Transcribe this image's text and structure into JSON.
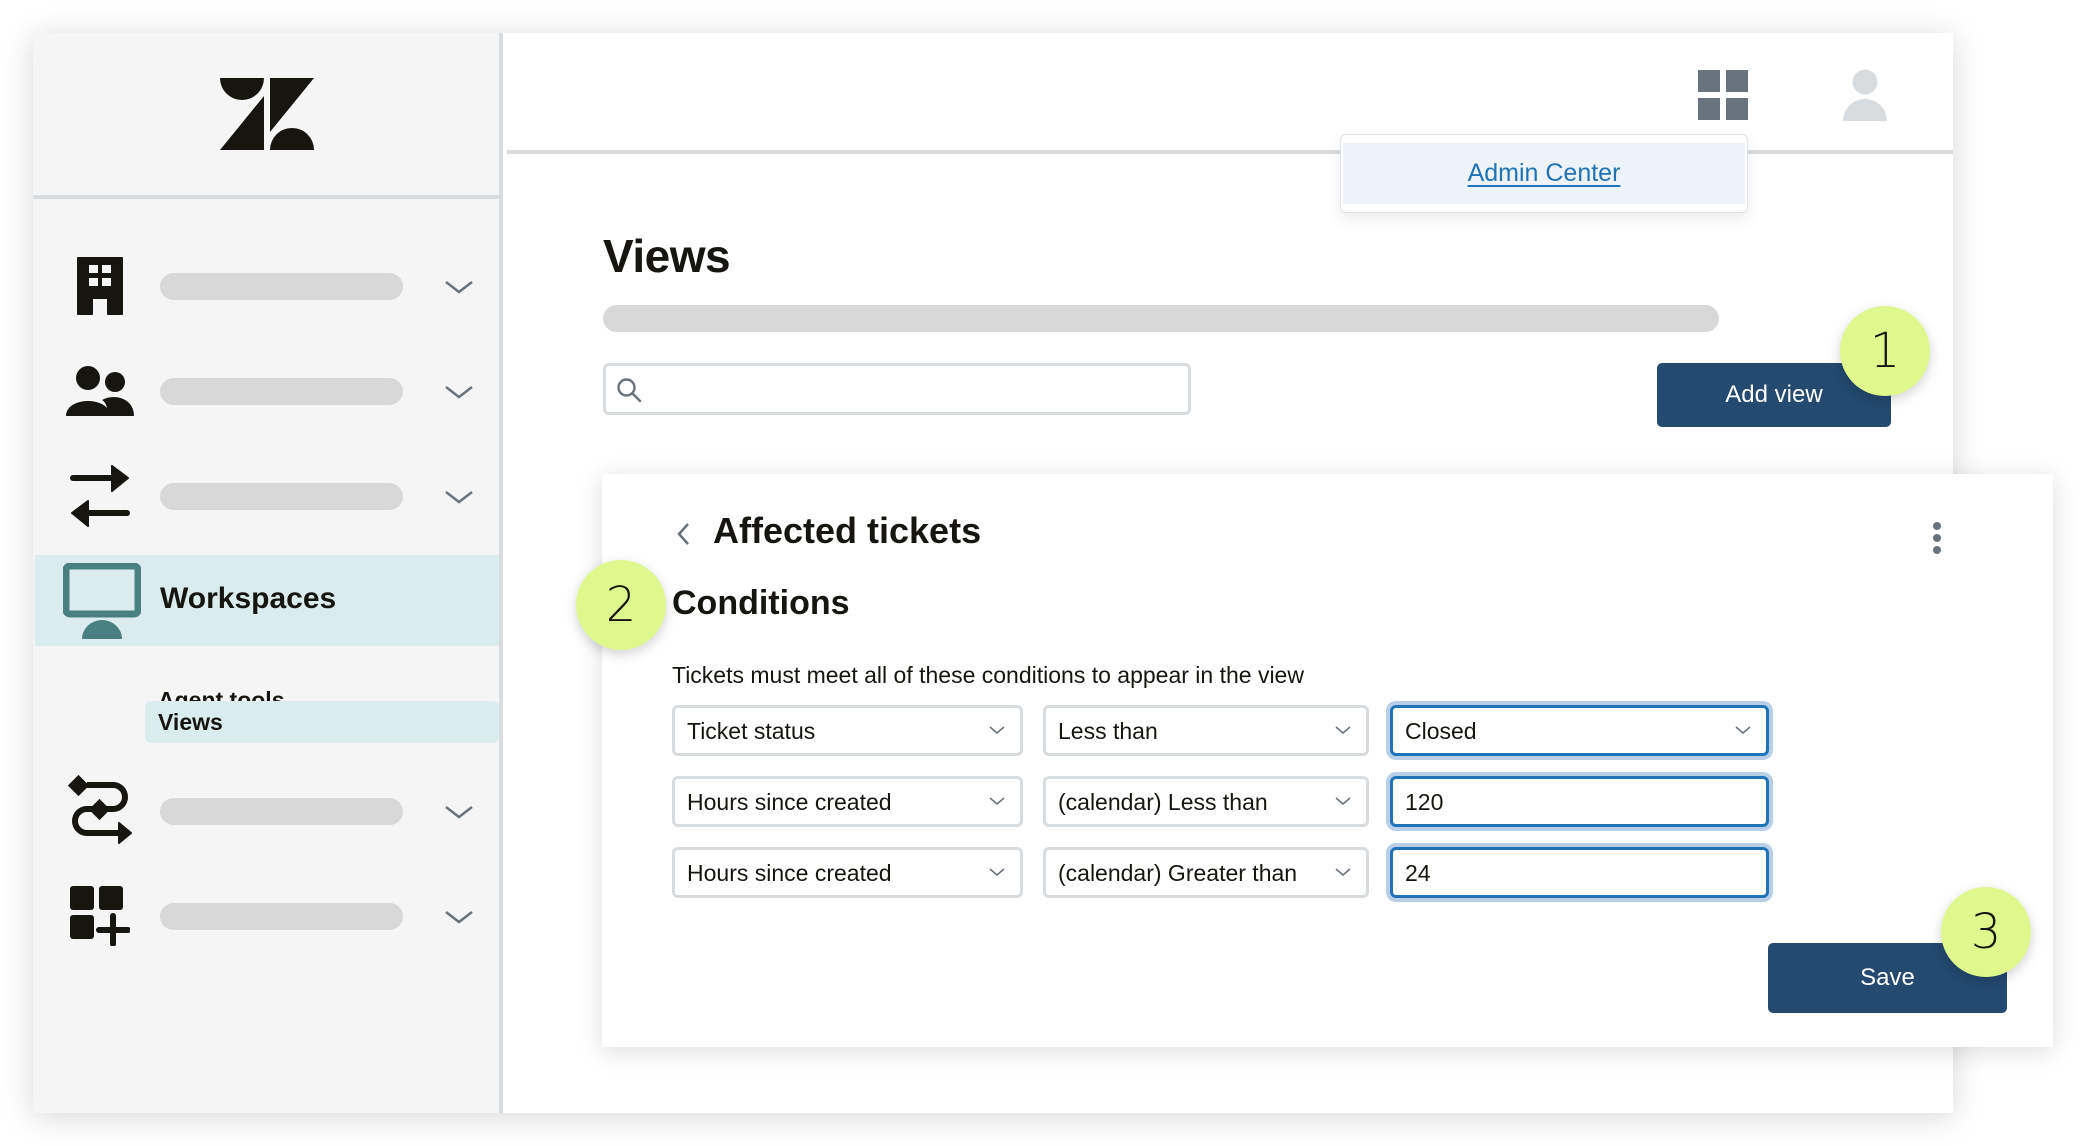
{
  "app": {
    "brand": "Zendesk"
  },
  "sidebar": {
    "items": [
      {
        "icon": "building-icon",
        "label": "",
        "expandable": true
      },
      {
        "icon": "people-icon",
        "label": "",
        "expandable": true
      },
      {
        "icon": "arrows-exchange-icon",
        "label": "",
        "expandable": true
      },
      {
        "icon": "monitor-icon",
        "label": "Workspaces",
        "active": true,
        "children": [
          {
            "label": "Agent tools",
            "active": false
          },
          {
            "label": "Views",
            "active": true
          }
        ]
      },
      {
        "icon": "workflow-icon",
        "label": "",
        "expandable": true
      },
      {
        "icon": "apps-add-icon",
        "label": "",
        "expandable": true
      }
    ]
  },
  "topbar": {
    "apps_icon": "grid-icon",
    "user_icon": "user-avatar-icon",
    "dropdown": {
      "item": "Admin Center"
    }
  },
  "page": {
    "title": "Views",
    "search": {
      "value": "",
      "placeholder": ""
    },
    "add_view_label": "Add view"
  },
  "panel": {
    "title": "Affected tickets",
    "section_title": "Conditions",
    "description": "Tickets must meet all of these conditions to appear in the view",
    "conditions": [
      {
        "field": "Ticket status",
        "operator": "Less than",
        "value": "Closed",
        "value_type": "select"
      },
      {
        "field": "Hours since created",
        "operator": "(calendar) Less than",
        "value": "120",
        "value_type": "text"
      },
      {
        "field": "Hours since created",
        "operator": "(calendar) Greater than",
        "value": "24",
        "value_type": "text"
      }
    ],
    "save_label": "Save"
  },
  "callouts": [
    "1",
    "2",
    "3"
  ],
  "colors": {
    "primary_button": "#244a70",
    "link": "#1f73b7",
    "callout": "#dff88d",
    "nav_active": "#daeced",
    "monitor_icon": "#4a8080"
  }
}
